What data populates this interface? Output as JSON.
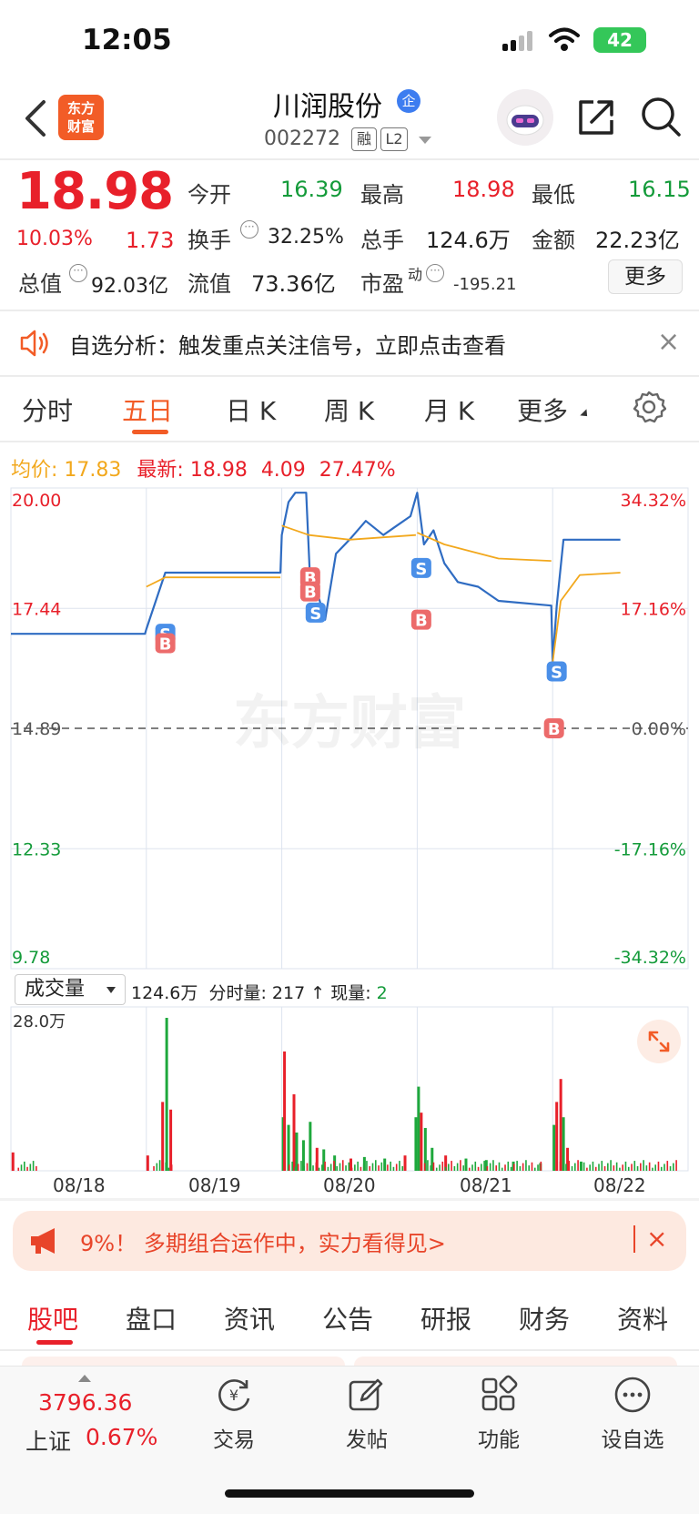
{
  "status": {
    "time": "12:05",
    "battery": "42"
  },
  "header": {
    "logo_line1": "东方",
    "logo_line2": "财富",
    "name": "川润股份",
    "qi_badge": "企",
    "code": "002272",
    "tag_rong": "融",
    "tag_l2": "L2"
  },
  "quote": {
    "price": "18.98",
    "pct": "10.03%",
    "change": "1.73",
    "open_label": "今开",
    "open": "16.39",
    "high_label": "最高",
    "high": "18.98",
    "low_label": "最低",
    "low": "16.15",
    "turnover_label": "换手",
    "turnover": "32.25%",
    "volume_label": "总手",
    "volume": "124.6万",
    "amount_label": "金额",
    "amount": "22.23亿",
    "mktcap_label": "总值",
    "mktcap": "92.03亿",
    "float_label": "流值",
    "float": "73.36亿",
    "pe_label": "市盈",
    "pe_sup": "动",
    "pe": "-195.21",
    "more_label": "更多"
  },
  "notice": {
    "text": "自选分析：触发重点关注信号，立即点击查看",
    "close": "×"
  },
  "tabs": [
    {
      "label": "分时"
    },
    {
      "label": "五日"
    },
    {
      "label": "日 K"
    },
    {
      "label": "周 K"
    },
    {
      "label": "月 K"
    },
    {
      "label": "更多"
    }
  ],
  "summary": {
    "avg_label": "均价:",
    "avg": "17.83",
    "latest_label": "最新:",
    "latest": "18.98",
    "diff": "4.09",
    "diff_pct": "27.47%"
  },
  "chart_data": {
    "type": "line",
    "y_left_ticks": [
      "20.00",
      "17.44",
      "14.89",
      "12.33",
      "9.78"
    ],
    "y_right_ticks": [
      "34.32%",
      "17.16%",
      "0.00%",
      "-17.16%",
      "-34.32%"
    ],
    "x_dates": [
      "08/18",
      "08/19",
      "08/20",
      "08/21",
      "08/22"
    ],
    "ylim": [
      9.78,
      20.0
    ],
    "base_price": 14.89,
    "watermark": "东方财富",
    "series": [
      {
        "name": "最新",
        "color": "#2f6cc2",
        "values": [
          [
            0,
            16.9
          ],
          [
            0.99,
            16.9
          ],
          [
            1.0,
            17.0
          ],
          [
            1.14,
            18.2
          ],
          [
            1.99,
            18.2
          ],
          [
            2.0,
            19.0
          ],
          [
            2.05,
            19.7
          ],
          [
            2.1,
            19.9
          ],
          [
            2.18,
            19.9
          ],
          [
            2.21,
            18.0
          ],
          [
            2.25,
            17.9
          ],
          [
            2.32,
            17.2
          ],
          [
            2.4,
            18.6
          ],
          [
            2.5,
            18.9
          ],
          [
            2.62,
            19.3
          ],
          [
            2.75,
            19.0
          ],
          [
            2.85,
            19.2
          ],
          [
            2.95,
            19.4
          ],
          [
            2.99,
            19.8
          ],
          [
            3.0,
            19.9
          ],
          [
            3.05,
            18.8
          ],
          [
            3.12,
            19.1
          ],
          [
            3.2,
            18.4
          ],
          [
            3.3,
            18.0
          ],
          [
            3.45,
            17.9
          ],
          [
            3.6,
            17.6
          ],
          [
            3.99,
            17.5
          ],
          [
            4.0,
            16.3
          ],
          [
            4.03,
            17.5
          ],
          [
            4.08,
            18.9
          ],
          [
            4.5,
            18.9
          ]
        ]
      },
      {
        "name": "均价",
        "color": "#f2a81d",
        "values": [
          [
            1.0,
            17.9
          ],
          [
            1.14,
            18.1
          ],
          [
            1.99,
            18.1
          ],
          [
            2.0,
            19.2
          ],
          [
            2.2,
            19.0
          ],
          [
            2.5,
            18.9
          ],
          [
            2.99,
            19.0
          ],
          [
            3.0,
            19.05
          ],
          [
            3.2,
            18.8
          ],
          [
            3.6,
            18.5
          ],
          [
            3.99,
            18.45
          ],
          [
            4.0,
            16.3
          ],
          [
            4.06,
            17.6
          ],
          [
            4.2,
            18.15
          ],
          [
            4.5,
            18.2
          ]
        ]
      }
    ],
    "signals": [
      {
        "type": "S",
        "x": 1.14,
        "y": 16.9
      },
      {
        "type": "B",
        "x": 1.14,
        "y": 16.7
      },
      {
        "type": "B",
        "x": 2.21,
        "y": 18.1
      },
      {
        "type": "B",
        "x": 2.21,
        "y": 17.8
      },
      {
        "type": "S",
        "x": 2.25,
        "y": 17.35
      },
      {
        "type": "S",
        "x": 3.03,
        "y": 18.3
      },
      {
        "type": "B",
        "x": 3.03,
        "y": 17.2
      },
      {
        "type": "S",
        "x": 4.03,
        "y": 16.1
      },
      {
        "type": "B",
        "x": 4.01,
        "y": 14.89
      }
    ]
  },
  "volume": {
    "selector": "成交量",
    "total": "124.6万",
    "minute_label": "分时量:",
    "minute": "217",
    "now_label": "现量:",
    "now": "2",
    "max_label": "28.0万",
    "bars": [
      {
        "x": 0.005,
        "v": 0.12,
        "c": "r"
      },
      {
        "x": 1.0,
        "v": 0.1,
        "c": "r"
      },
      {
        "x": 1.11,
        "v": 0.45,
        "c": "r"
      },
      {
        "x": 1.14,
        "v": 1.0,
        "c": "g"
      },
      {
        "x": 1.17,
        "v": 0.4,
        "c": "r"
      },
      {
        "x": 2.0,
        "v": 0.35,
        "c": "g"
      },
      {
        "x": 2.01,
        "v": 0.78,
        "c": "r"
      },
      {
        "x": 2.04,
        "v": 0.3,
        "c": "g"
      },
      {
        "x": 2.08,
        "v": 0.5,
        "c": "r"
      },
      {
        "x": 2.1,
        "v": 0.25,
        "c": "g"
      },
      {
        "x": 2.15,
        "v": 0.2,
        "c": "g"
      },
      {
        "x": 2.2,
        "v": 0.32,
        "c": "g"
      },
      {
        "x": 2.25,
        "v": 0.15,
        "c": "r"
      },
      {
        "x": 2.3,
        "v": 0.14,
        "c": "g"
      },
      {
        "x": 2.38,
        "v": 0.1,
        "c": "g"
      },
      {
        "x": 2.5,
        "v": 0.08,
        "c": "r"
      },
      {
        "x": 2.6,
        "v": 0.09,
        "c": "g"
      },
      {
        "x": 2.75,
        "v": 0.08,
        "c": "g"
      },
      {
        "x": 2.9,
        "v": 0.1,
        "c": "r"
      },
      {
        "x": 2.98,
        "v": 0.35,
        "c": "g"
      },
      {
        "x": 3.0,
        "v": 0.55,
        "c": "g"
      },
      {
        "x": 3.02,
        "v": 0.38,
        "c": "r"
      },
      {
        "x": 3.05,
        "v": 0.28,
        "c": "g"
      },
      {
        "x": 3.1,
        "v": 0.15,
        "c": "g"
      },
      {
        "x": 3.2,
        "v": 0.1,
        "c": "r"
      },
      {
        "x": 3.35,
        "v": 0.08,
        "c": "g"
      },
      {
        "x": 3.5,
        "v": 0.07,
        "c": "g"
      },
      {
        "x": 3.7,
        "v": 0.06,
        "c": "g"
      },
      {
        "x": 3.9,
        "v": 0.05,
        "c": "g"
      },
      {
        "x": 4.0,
        "v": 0.3,
        "c": "g"
      },
      {
        "x": 4.02,
        "v": 0.45,
        "c": "r"
      },
      {
        "x": 4.05,
        "v": 0.6,
        "c": "r"
      },
      {
        "x": 4.07,
        "v": 0.35,
        "c": "g"
      },
      {
        "x": 4.1,
        "v": 0.15,
        "c": "r"
      },
      {
        "x": 4.2,
        "v": 0.06,
        "c": "g"
      }
    ]
  },
  "promo": {
    "text": "9%！ 多期组合运作中，实力看得见>",
    "close": "×"
  },
  "bottom_tabs": [
    {
      "label": "股吧"
    },
    {
      "label": "盘口"
    },
    {
      "label": "资讯"
    },
    {
      "label": "公告"
    },
    {
      "label": "研报"
    },
    {
      "label": "财务"
    },
    {
      "label": "资料"
    }
  ],
  "toolbar": {
    "index_value": "3796.36",
    "index_name": "上证",
    "index_pct": "0.67%",
    "items": [
      {
        "label": "交易",
        "icon": "trade-icon"
      },
      {
        "label": "发帖",
        "icon": "post-icon"
      },
      {
        "label": "功能",
        "icon": "apps-icon"
      },
      {
        "label": "设自选",
        "icon": "add-watchlist-icon"
      }
    ]
  }
}
